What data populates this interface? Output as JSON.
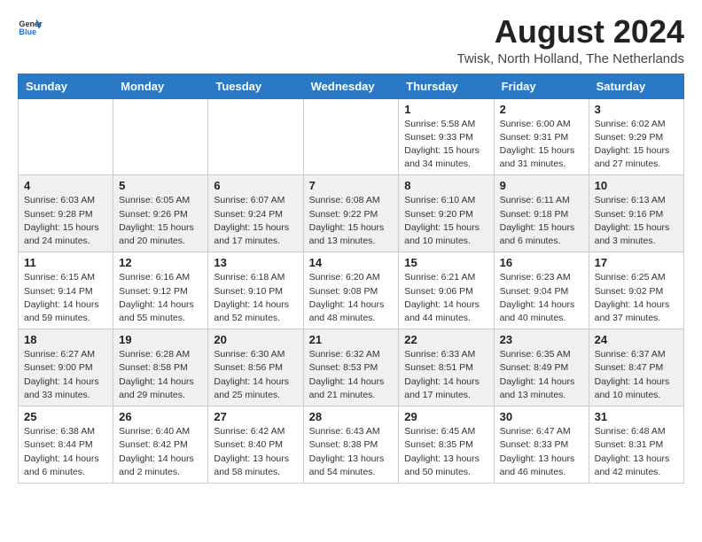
{
  "header": {
    "logo_general": "General",
    "logo_blue": "Blue",
    "month_year": "August 2024",
    "location": "Twisk, North Holland, The Netherlands"
  },
  "days_of_week": [
    "Sunday",
    "Monday",
    "Tuesday",
    "Wednesday",
    "Thursday",
    "Friday",
    "Saturday"
  ],
  "weeks": [
    [
      {
        "day": "",
        "sunrise": "",
        "sunset": "",
        "daylight": ""
      },
      {
        "day": "",
        "sunrise": "",
        "sunset": "",
        "daylight": ""
      },
      {
        "day": "",
        "sunrise": "",
        "sunset": "",
        "daylight": ""
      },
      {
        "day": "",
        "sunrise": "",
        "sunset": "",
        "daylight": ""
      },
      {
        "day": "1",
        "sunrise": "Sunrise: 5:58 AM",
        "sunset": "Sunset: 9:33 PM",
        "daylight": "Daylight: 15 hours and 34 minutes."
      },
      {
        "day": "2",
        "sunrise": "Sunrise: 6:00 AM",
        "sunset": "Sunset: 9:31 PM",
        "daylight": "Daylight: 15 hours and 31 minutes."
      },
      {
        "day": "3",
        "sunrise": "Sunrise: 6:02 AM",
        "sunset": "Sunset: 9:29 PM",
        "daylight": "Daylight: 15 hours and 27 minutes."
      }
    ],
    [
      {
        "day": "4",
        "sunrise": "Sunrise: 6:03 AM",
        "sunset": "Sunset: 9:28 PM",
        "daylight": "Daylight: 15 hours and 24 minutes."
      },
      {
        "day": "5",
        "sunrise": "Sunrise: 6:05 AM",
        "sunset": "Sunset: 9:26 PM",
        "daylight": "Daylight: 15 hours and 20 minutes."
      },
      {
        "day": "6",
        "sunrise": "Sunrise: 6:07 AM",
        "sunset": "Sunset: 9:24 PM",
        "daylight": "Daylight: 15 hours and 17 minutes."
      },
      {
        "day": "7",
        "sunrise": "Sunrise: 6:08 AM",
        "sunset": "Sunset: 9:22 PM",
        "daylight": "Daylight: 15 hours and 13 minutes."
      },
      {
        "day": "8",
        "sunrise": "Sunrise: 6:10 AM",
        "sunset": "Sunset: 9:20 PM",
        "daylight": "Daylight: 15 hours and 10 minutes."
      },
      {
        "day": "9",
        "sunrise": "Sunrise: 6:11 AM",
        "sunset": "Sunset: 9:18 PM",
        "daylight": "Daylight: 15 hours and 6 minutes."
      },
      {
        "day": "10",
        "sunrise": "Sunrise: 6:13 AM",
        "sunset": "Sunset: 9:16 PM",
        "daylight": "Daylight: 15 hours and 3 minutes."
      }
    ],
    [
      {
        "day": "11",
        "sunrise": "Sunrise: 6:15 AM",
        "sunset": "Sunset: 9:14 PM",
        "daylight": "Daylight: 14 hours and 59 minutes."
      },
      {
        "day": "12",
        "sunrise": "Sunrise: 6:16 AM",
        "sunset": "Sunset: 9:12 PM",
        "daylight": "Daylight: 14 hours and 55 minutes."
      },
      {
        "day": "13",
        "sunrise": "Sunrise: 6:18 AM",
        "sunset": "Sunset: 9:10 PM",
        "daylight": "Daylight: 14 hours and 52 minutes."
      },
      {
        "day": "14",
        "sunrise": "Sunrise: 6:20 AM",
        "sunset": "Sunset: 9:08 PM",
        "daylight": "Daylight: 14 hours and 48 minutes."
      },
      {
        "day": "15",
        "sunrise": "Sunrise: 6:21 AM",
        "sunset": "Sunset: 9:06 PM",
        "daylight": "Daylight: 14 hours and 44 minutes."
      },
      {
        "day": "16",
        "sunrise": "Sunrise: 6:23 AM",
        "sunset": "Sunset: 9:04 PM",
        "daylight": "Daylight: 14 hours and 40 minutes."
      },
      {
        "day": "17",
        "sunrise": "Sunrise: 6:25 AM",
        "sunset": "Sunset: 9:02 PM",
        "daylight": "Daylight: 14 hours and 37 minutes."
      }
    ],
    [
      {
        "day": "18",
        "sunrise": "Sunrise: 6:27 AM",
        "sunset": "Sunset: 9:00 PM",
        "daylight": "Daylight: 14 hours and 33 minutes."
      },
      {
        "day": "19",
        "sunrise": "Sunrise: 6:28 AM",
        "sunset": "Sunset: 8:58 PM",
        "daylight": "Daylight: 14 hours and 29 minutes."
      },
      {
        "day": "20",
        "sunrise": "Sunrise: 6:30 AM",
        "sunset": "Sunset: 8:56 PM",
        "daylight": "Daylight: 14 hours and 25 minutes."
      },
      {
        "day": "21",
        "sunrise": "Sunrise: 6:32 AM",
        "sunset": "Sunset: 8:53 PM",
        "daylight": "Daylight: 14 hours and 21 minutes."
      },
      {
        "day": "22",
        "sunrise": "Sunrise: 6:33 AM",
        "sunset": "Sunset: 8:51 PM",
        "daylight": "Daylight: 14 hours and 17 minutes."
      },
      {
        "day": "23",
        "sunrise": "Sunrise: 6:35 AM",
        "sunset": "Sunset: 8:49 PM",
        "daylight": "Daylight: 14 hours and 13 minutes."
      },
      {
        "day": "24",
        "sunrise": "Sunrise: 6:37 AM",
        "sunset": "Sunset: 8:47 PM",
        "daylight": "Daylight: 14 hours and 10 minutes."
      }
    ],
    [
      {
        "day": "25",
        "sunrise": "Sunrise: 6:38 AM",
        "sunset": "Sunset: 8:44 PM",
        "daylight": "Daylight: 14 hours and 6 minutes."
      },
      {
        "day": "26",
        "sunrise": "Sunrise: 6:40 AM",
        "sunset": "Sunset: 8:42 PM",
        "daylight": "Daylight: 14 hours and 2 minutes."
      },
      {
        "day": "27",
        "sunrise": "Sunrise: 6:42 AM",
        "sunset": "Sunset: 8:40 PM",
        "daylight": "Daylight: 13 hours and 58 minutes."
      },
      {
        "day": "28",
        "sunrise": "Sunrise: 6:43 AM",
        "sunset": "Sunset: 8:38 PM",
        "daylight": "Daylight: 13 hours and 54 minutes."
      },
      {
        "day": "29",
        "sunrise": "Sunrise: 6:45 AM",
        "sunset": "Sunset: 8:35 PM",
        "daylight": "Daylight: 13 hours and 50 minutes."
      },
      {
        "day": "30",
        "sunrise": "Sunrise: 6:47 AM",
        "sunset": "Sunset: 8:33 PM",
        "daylight": "Daylight: 13 hours and 46 minutes."
      },
      {
        "day": "31",
        "sunrise": "Sunrise: 6:48 AM",
        "sunset": "Sunset: 8:31 PM",
        "daylight": "Daylight: 13 hours and 42 minutes."
      }
    ]
  ]
}
